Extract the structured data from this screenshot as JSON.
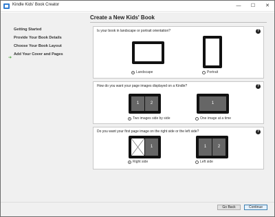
{
  "window": {
    "title": "Kindle Kids' Book Creator"
  },
  "sidebar": {
    "items": [
      {
        "label": "Getting Started"
      },
      {
        "label": "Provide Your Book Details"
      },
      {
        "label": "Choose Your Book Layout"
      },
      {
        "label": "Add Your Cover and Pages"
      }
    ]
  },
  "main": {
    "title": "Create a New Kids' Book",
    "sections": [
      {
        "question": "Is your book in landscape or portrait orientation?",
        "options": [
          {
            "label": "Landscape",
            "selected": true
          },
          {
            "label": "Portrait",
            "selected": false
          }
        ]
      },
      {
        "question": "How do you want your page images displayed on a Kindle?",
        "options": [
          {
            "label": "Two images side by side",
            "selected": true,
            "pages": [
              "1",
              "2"
            ]
          },
          {
            "label": "One image at a time",
            "selected": false,
            "pages": [
              "1"
            ]
          }
        ]
      },
      {
        "question": "Do you want your first page image on the right side or the left side?",
        "options": [
          {
            "label": "Right side",
            "selected": true,
            "pages": [
              "1"
            ]
          },
          {
            "label": "Left side",
            "selected": false,
            "pages": [
              "1",
              "2"
            ]
          }
        ]
      }
    ]
  },
  "footer": {
    "back_label": "Go Back",
    "continue_label": "Continue"
  },
  "icons": {
    "help": "?"
  }
}
